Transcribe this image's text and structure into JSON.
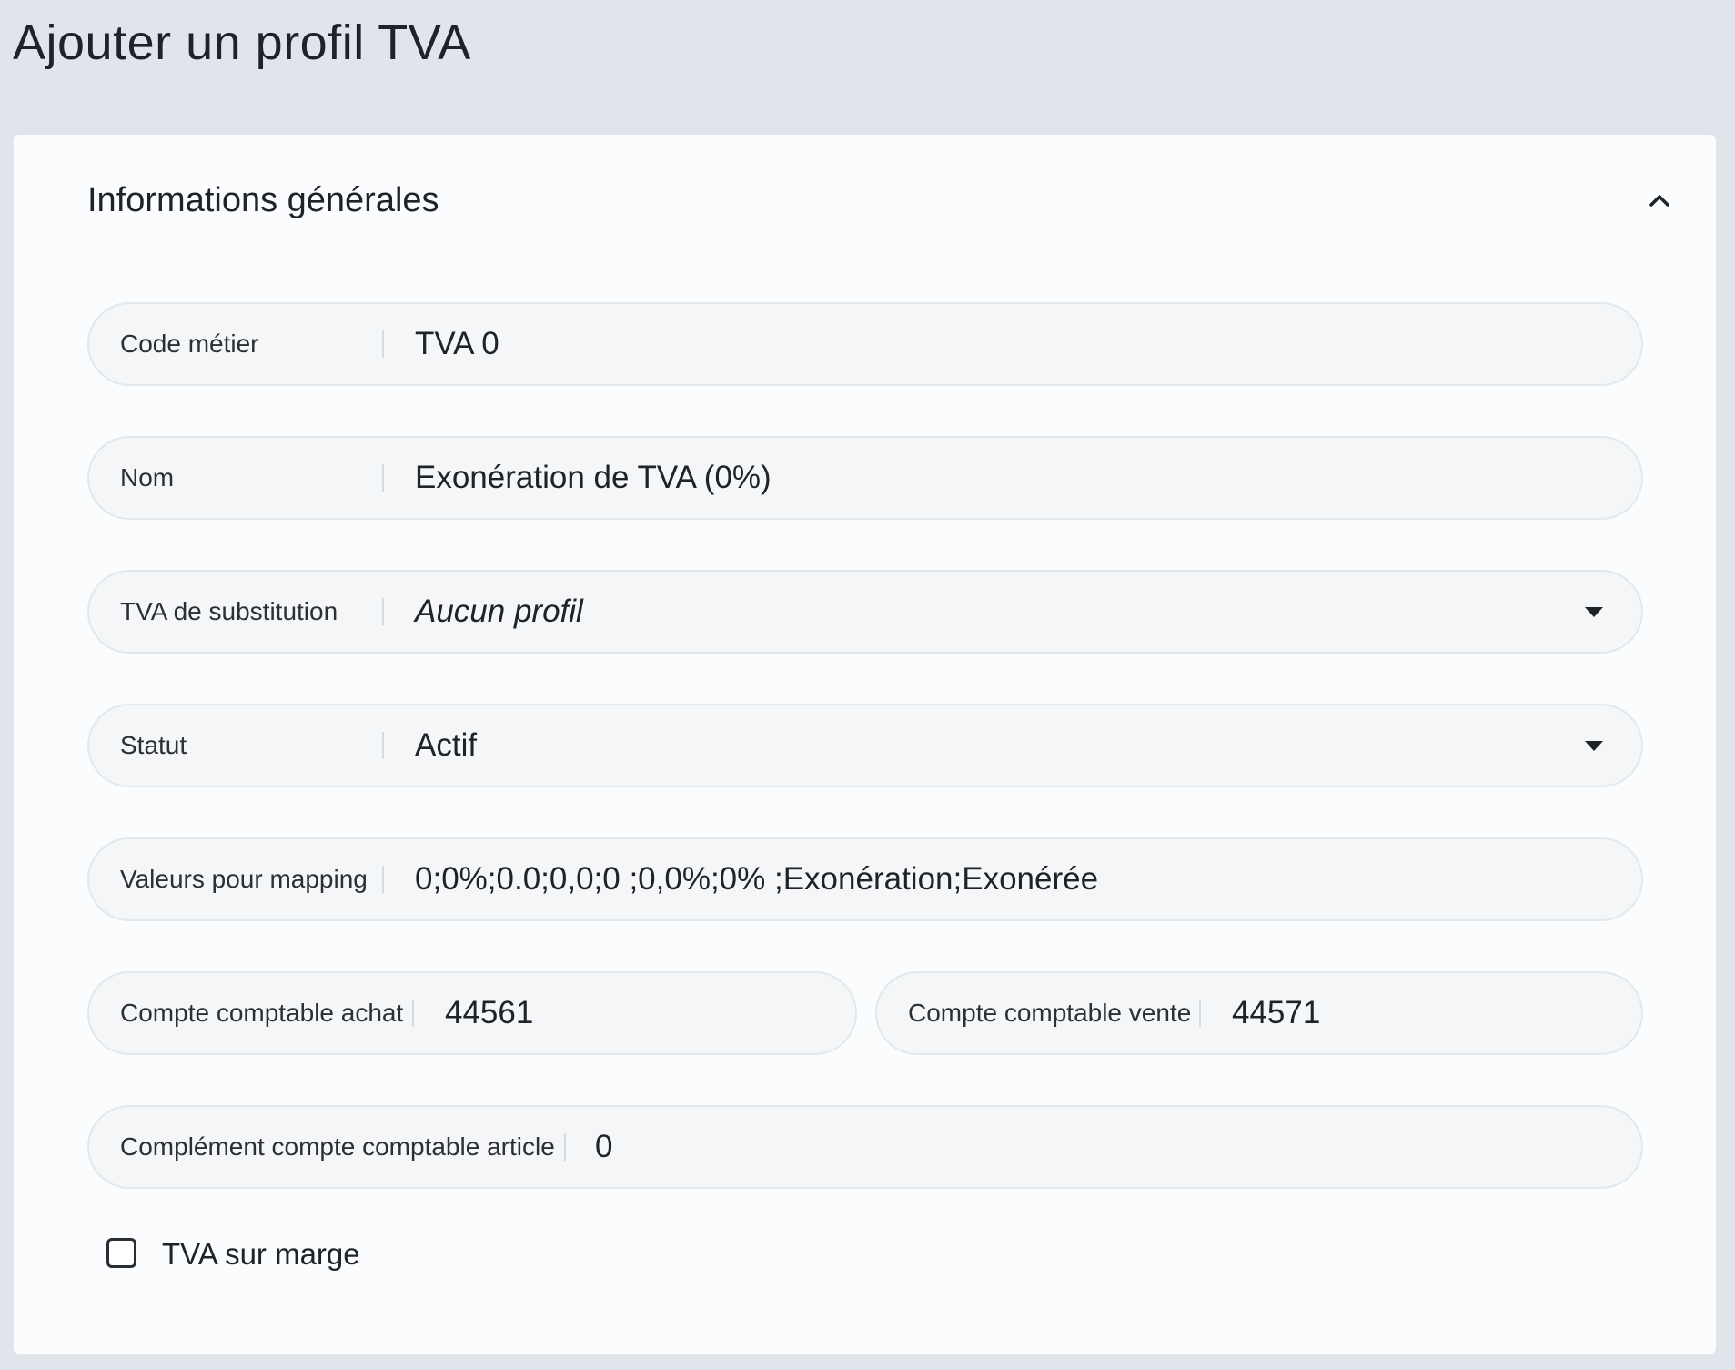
{
  "page": {
    "title": "Ajouter un profil TVA"
  },
  "section": {
    "title": "Informations générales",
    "toggle_icon": "chevron-up-icon"
  },
  "fields": {
    "code_metier": {
      "label": "Code métier",
      "value": "TVA 0"
    },
    "nom": {
      "label": "Nom",
      "value": "Exonération de TVA (0%)"
    },
    "tva_substitution": {
      "label": "TVA de substitution",
      "value": "Aucun profil",
      "icon": "caret-down-icon"
    },
    "statut": {
      "label": "Statut",
      "value": "Actif",
      "icon": "caret-down-icon"
    },
    "valeurs_mapping": {
      "label": "Valeurs pour mapping",
      "value": "0;0%;0.0;0,0;0 ;0,0%;0% ;Exonération;Exonérée"
    },
    "compte_achat": {
      "label": "Compte comptable achat",
      "value": "44561"
    },
    "compte_vente": {
      "label": "Compte comptable vente",
      "value": "44571"
    },
    "complement_compte": {
      "label": "Complément compte comptable article",
      "value": "0"
    }
  },
  "checkbox": {
    "label": "TVA sur marge",
    "checked": false
  }
}
